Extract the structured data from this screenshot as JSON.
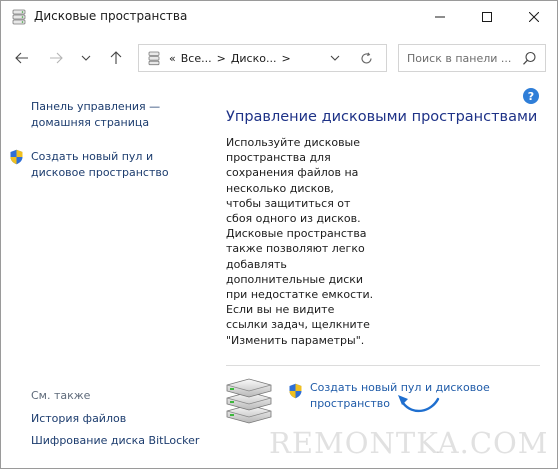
{
  "window": {
    "title": "Дисковые пространства"
  },
  "navbar": {
    "breadcrumbs": [
      "«",
      "Все...",
      ">",
      "Диско...",
      ">"
    ],
    "search_placeholder": "Поиск в панели ..."
  },
  "left_pane": {
    "home_link": "Панель управления — домашняя страница",
    "create_link": "Создать новый пул и дисковое пространство",
    "see_also": "См. также",
    "file_history": "История файлов",
    "bitlocker": "Шифрование диска BitLocker"
  },
  "main": {
    "heading": "Управление дисковыми пространствами",
    "description_lines": [
      "Используйте дисковые",
      "пространства для",
      "сохранения файлов на",
      "несколько дисков,",
      "чтобы защититься от",
      "сбоя одного из дисков.",
      "Дисковые пространства",
      "также позволяют легко",
      "добавлять",
      "дополнительные диски",
      "при недостатке емкости.",
      "Если вы не видите",
      "ссылки задач, щелкните",
      "\"Изменить параметры\"."
    ],
    "task_link": "Создать новый пул и дисковое пространство"
  },
  "help_label": "?",
  "watermark": "REMONTKA.COM",
  "colors": {
    "link": "#1c3c6e",
    "heading": "#1e3287",
    "task_link": "#1f5ba8",
    "help": "#2f7ed8",
    "arrow": "#1f6fcf"
  },
  "icons": [
    "disk-spaces-icon",
    "minimize-icon",
    "maximize-icon",
    "close-icon",
    "back-arrow-icon",
    "forward-arrow-icon",
    "chevron-down-icon",
    "up-arrow-icon",
    "refresh-icon",
    "search-icon",
    "help-icon",
    "uac-shield-icon",
    "disk-stack-icon",
    "annotation-arrow"
  ]
}
